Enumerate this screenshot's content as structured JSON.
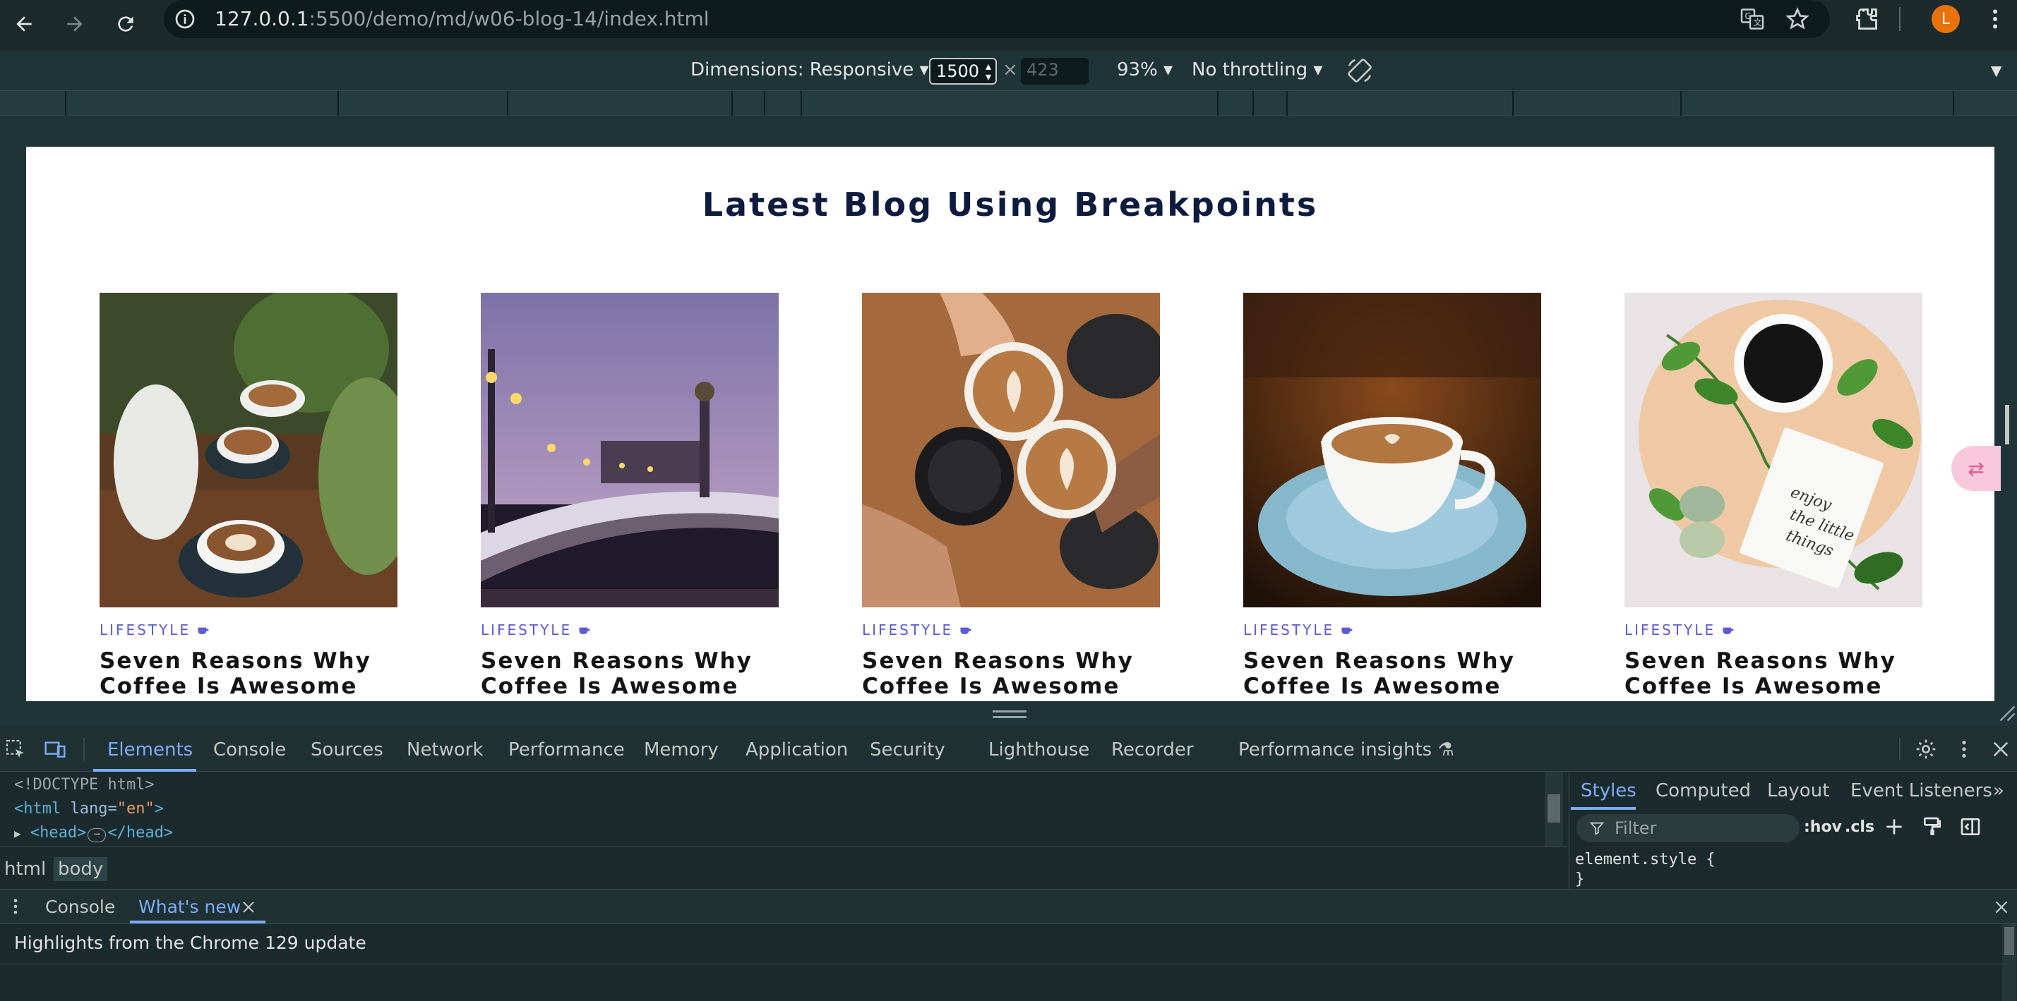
{
  "browser": {
    "url_host": "127.0.0.1",
    "url_rest": ":5500/demo/md/w06-blog-14/index.html",
    "profile_initial": "L"
  },
  "device_toolbar": {
    "dimensions_label": "Dimensions: Responsive",
    "width_value": "1500",
    "times": "×",
    "height_placeholder": "423",
    "zoom": "93%",
    "throttling": "No throttling"
  },
  "page": {
    "heading": "Latest Blog Using Breakpoints",
    "cards": [
      {
        "category": "LIFESTYLE",
        "title_line1": "Seven Reasons Why",
        "title_line2": "Coffee Is Awesome"
      },
      {
        "category": "LIFESTYLE",
        "title_line1": "Seven Reasons Why",
        "title_line2": "Coffee Is Awesome"
      },
      {
        "category": "LIFESTYLE",
        "title_line1": "Seven Reasons Why",
        "title_line2": "Coffee Is Awesome"
      },
      {
        "category": "LIFESTYLE",
        "title_line1": "Seven Reasons Why",
        "title_line2": "Coffee Is Awesome"
      },
      {
        "category": "LIFESTYLE",
        "title_line1": "Seven Reasons Why",
        "title_line2": "Coffee Is Awesome"
      }
    ]
  },
  "devtools": {
    "tabs": [
      "Elements",
      "Console",
      "Sources",
      "Network",
      "Performance",
      "Memory",
      "Application",
      "Security",
      "Lighthouse",
      "Recorder",
      "Performance insights"
    ],
    "dom": {
      "doctype": "<!DOCTYPE html>",
      "html_open_tag": "<html",
      "html_attr": "lang=",
      "html_attr_val": "\"en\"",
      "html_close": ">",
      "head_open": "<head>",
      "head_close": "</head>"
    },
    "breadcrumbs": [
      "html",
      "body"
    ],
    "styles_tabs": [
      "Styles",
      "Computed",
      "Layout",
      "Event Listeners"
    ],
    "filter_placeholder": "Filter",
    "hov": ":hov",
    "cls": ".cls",
    "element_style": "element.style {",
    "element_style_close": "}"
  },
  "drawer": {
    "tabs": [
      "Console",
      "What's new"
    ],
    "highlight": "Highlights from the Chrome 129 update"
  },
  "colors": {
    "accent": "#7cacf8",
    "category": "#5b5bd6",
    "heading": "#0d1b3e"
  }
}
